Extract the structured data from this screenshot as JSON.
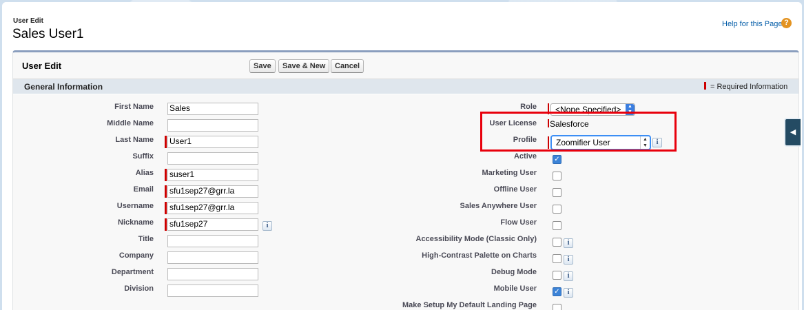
{
  "header": {
    "page_type": "User Edit",
    "title": "Sales User1",
    "help_link": "Help for this Page",
    "help_icon": "help-icon"
  },
  "block": {
    "title": "User Edit",
    "buttons": {
      "save": "Save",
      "save_new": "Save & New",
      "cancel": "Cancel"
    }
  },
  "section": {
    "title": "General Information",
    "required_legend": "= Required Information"
  },
  "left_fields": [
    {
      "label": "First Name",
      "value": "Sales",
      "required": false
    },
    {
      "label": "Middle Name",
      "value": "",
      "required": false
    },
    {
      "label": "Last Name",
      "value": "User1",
      "required": true
    },
    {
      "label": "Suffix",
      "value": "",
      "required": false
    },
    {
      "label": "Alias",
      "value": "suser1",
      "required": true
    },
    {
      "label": "Email",
      "value": "sfu1sep27@grr.la",
      "required": true
    },
    {
      "label": "Username",
      "value": "sfu1sep27@grr.la",
      "required": true
    },
    {
      "label": "Nickname",
      "value": "sfu1sep27",
      "required": true
    },
    {
      "label": "Title",
      "value": "",
      "required": false
    },
    {
      "label": "Company",
      "value": "",
      "required": false
    },
    {
      "label": "Department",
      "value": "",
      "required": false
    },
    {
      "label": "Division",
      "value": "",
      "required": false
    }
  ],
  "right_fields": {
    "role": {
      "label": "Role",
      "value": "<None Specified>"
    },
    "user_license": {
      "label": "User License",
      "value": "Salesforce"
    },
    "profile": {
      "label": "Profile",
      "value": "Zoomifier User"
    },
    "checkboxes": [
      {
        "label": "Active",
        "checked": true
      },
      {
        "label": "Marketing User",
        "checked": false
      },
      {
        "label": "Offline User",
        "checked": false
      },
      {
        "label": "Sales Anywhere User",
        "checked": false
      },
      {
        "label": "Flow User",
        "checked": false
      },
      {
        "label": "Accessibility Mode (Classic Only)",
        "checked": false
      },
      {
        "label": "High-Contrast Palette on Charts",
        "checked": false
      },
      {
        "label": "Debug Mode",
        "checked": false
      },
      {
        "label": "Mobile User",
        "checked": true
      },
      {
        "label": "Make Setup My Default Landing Page",
        "checked": false
      }
    ]
  },
  "info_icon_glyph": "i",
  "checkmark_glyph": "✓",
  "side_tab_glyph": "◀",
  "colors": {
    "required": "#cc0000",
    "highlight": "#e8000c",
    "accent": "#3b7ee0"
  }
}
